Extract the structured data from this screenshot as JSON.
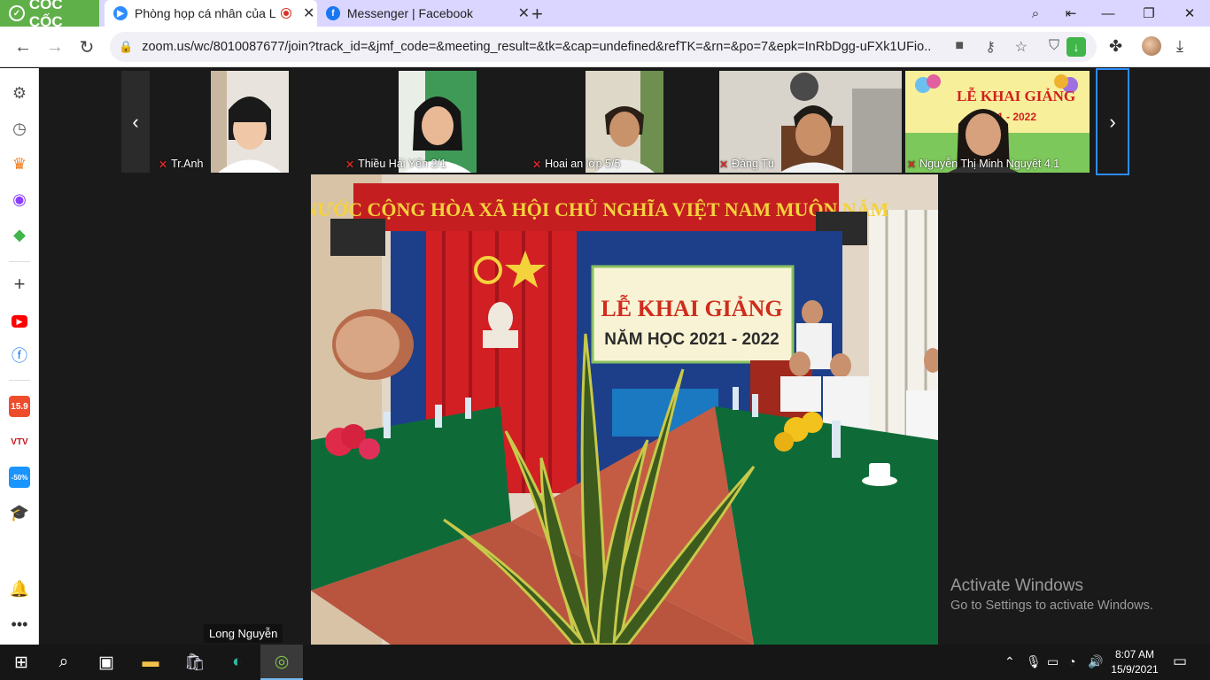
{
  "browser": {
    "brand": "CỐC CỐC",
    "tabs": [
      {
        "title": "Phòng họp cá nhân của L",
        "favicon": "zoom-icon",
        "active": true,
        "recording": true
      },
      {
        "title": "Messenger | Facebook",
        "favicon": "facebook-icon",
        "active": false
      }
    ],
    "new_tab": "+",
    "url": "zoom.us/wc/8010087677/join?track_id=&jmf_code=&meeting_result=&tk=&cap=undefined&refTK=&rn=&po=7&epk=InRbDgg-uFXk1UFio..."
  },
  "gallery": {
    "participants": [
      {
        "name": "Tr.Anh",
        "muted": true
      },
      {
        "name": "Thiều Hải Yến 2/1",
        "muted": true
      },
      {
        "name": "Hoai an lớp 5/5",
        "muted": true
      },
      {
        "name": "Đăng Tú",
        "muted": true
      },
      {
        "name": "Nguyễn Thị Minh Nguyệt 4.1",
        "muted": true
      }
    ]
  },
  "main_video": {
    "banner": "NƯỚC CỘNG HÒA XÃ HỘI CHỦ NGHĨA VIỆT NAM MUÔN NĂM",
    "stage_title": "LỄ KHAI GIẢNG",
    "stage_year": "NĂM HỌC 2021 - 2022"
  },
  "active_speaker": "Long Nguyễn",
  "watermark": {
    "title": "Activate Windows",
    "subtitle": "Go to Settings to activate Windows."
  },
  "taskbar": {
    "time": "8:07 AM",
    "date": "15/9/2021"
  },
  "colors": {
    "tabstrip": "#dad6ff",
    "brand": "#5fb048",
    "zoom_bg": "#1a1a1a",
    "selection": "#2d8cff"
  }
}
